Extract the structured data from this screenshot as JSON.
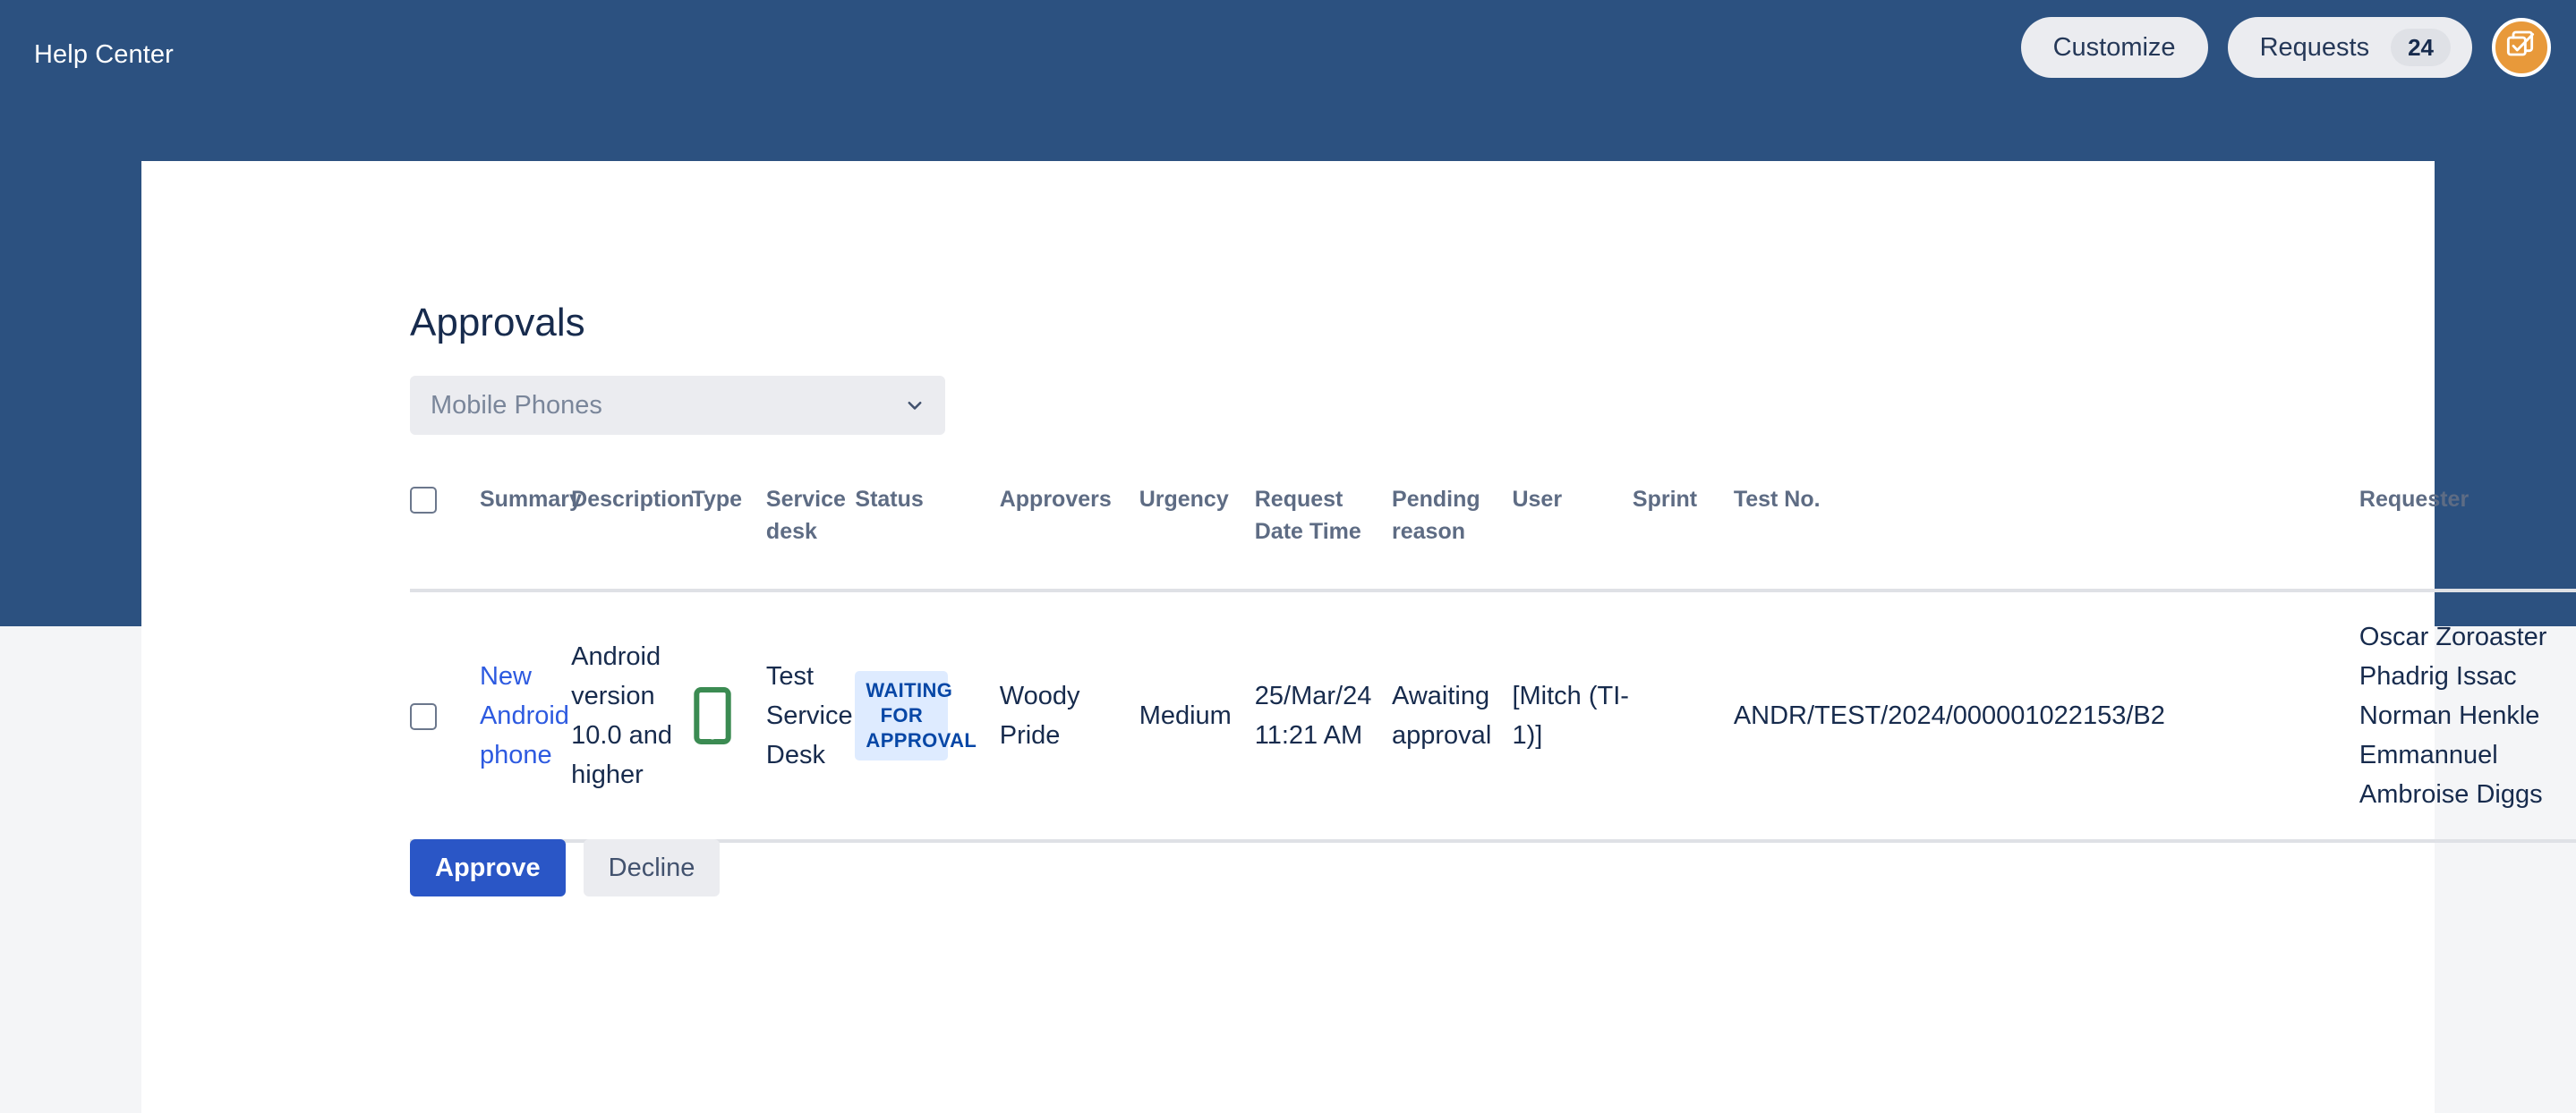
{
  "header": {
    "brand": "Help Center",
    "customize_label": "Customize",
    "requests_label": "Requests",
    "requests_count": "24",
    "avatar_icon": "checklist-icon"
  },
  "main": {
    "page_title": "Approvals",
    "filter": {
      "selected": "Mobile Phones",
      "chevron_icon": "chevron-down-icon"
    },
    "table": {
      "columns": [
        "Summary",
        "Description",
        "Type",
        "Service desk",
        "Status",
        "Approvers",
        "Urgency",
        "Request Date Time",
        "Pending reason",
        "User",
        "Sprint",
        "Test No.",
        "Requester"
      ],
      "rows": [
        {
          "summary": "New Android phone",
          "description": "Android version 10.0 and higher",
          "type_icon": "mobile-phone-icon",
          "service_desk": "Test Service Desk",
          "status": "WAITING FOR APPROVAL",
          "approvers": "Woody Pride",
          "urgency": "Medium",
          "request_date_time": "25/Mar/24 11:21 AM",
          "pending_reason": "Awaiting approval",
          "user": "[Mitch (TI-1)]",
          "sprint": "",
          "test_no": "ANDR/TEST/2024/000001022153/B2",
          "requester": "Oscar Zoroaster Phadrig Issac Norman Henkle Emmannuel Ambroise Diggs"
        }
      ]
    },
    "actions": {
      "approve_label": "Approve",
      "decline_label": "Decline"
    }
  },
  "colors": {
    "banner": "#2c5180",
    "primary_button": "#2a56c6",
    "link": "#2d5ae0",
    "status_badge_bg": "#deebff",
    "status_badge_text": "#0747a6",
    "avatar_bg": "#e8993a",
    "type_icon": "#3b8b52"
  }
}
